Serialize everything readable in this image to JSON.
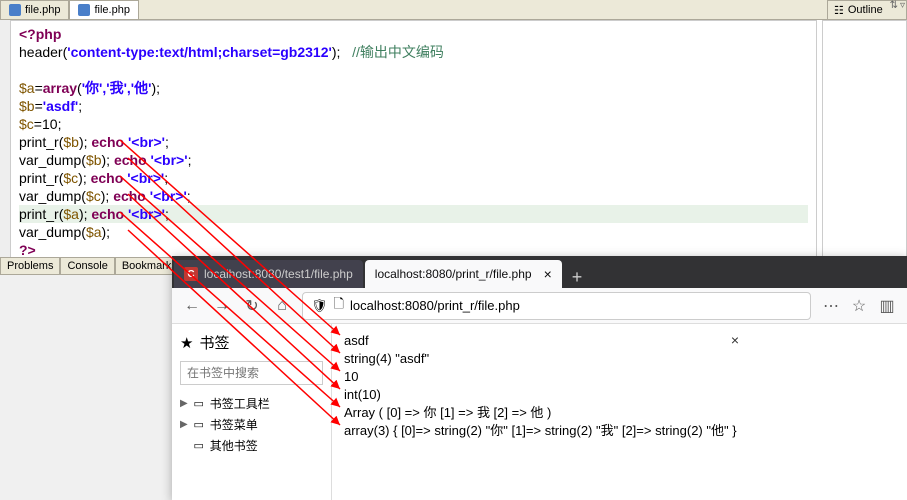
{
  "ide": {
    "tab1": "file.php",
    "tab2": "file.php",
    "outline": "Outline",
    "bottom_tabs": [
      "Problems",
      "Console",
      "Bookmarks"
    ]
  },
  "code": {
    "l1_open": "<?php",
    "l2_header": "header",
    "l2_str": "'content-type:text/html;charset=gb2312'",
    "l2_comment": "//输出中文编码",
    "l4_var": "$a",
    "l4_array": "array",
    "l4_args": "'你','我','他'",
    "l5_var": "$b",
    "l5_val": "'asdf'",
    "l6_var": "$c",
    "l6_val": "10",
    "l7": "print_r",
    "l7v": "$b",
    "l8": "var_dump",
    "l8v": "$b",
    "l9": "print_r",
    "l9v": "$c",
    "l10": "var_dump",
    "l10v": "$c",
    "l11": "print_r",
    "l11v": "$a",
    "l12": "var_dump",
    "l12v": "$a",
    "echo": "echo",
    "br": "'<br>'",
    "close": "?>"
  },
  "browser": {
    "tab1": "localhost:8080/test1/file.php",
    "tab2": "localhost:8080/print_r/file.php",
    "url": "localhost:8080/print_r/file.php",
    "plus": "+"
  },
  "bookmarks": {
    "title": "书签",
    "search_ph": "在书签中搜索",
    "item1": "书签工具栏",
    "item2": "书签菜单",
    "item3": "其他书签"
  },
  "output": {
    "l1": "asdf",
    "l2": "string(4) \"asdf\"",
    "l3": "10",
    "l4": "int(10)",
    "l5": "Array ( [0] => 你 [1] => 我 [2] => 他 )",
    "l6": "array(3) { [0]=> string(2) \"你\" [1]=> string(2) \"我\" [2]=> string(2) \"他\" }"
  }
}
